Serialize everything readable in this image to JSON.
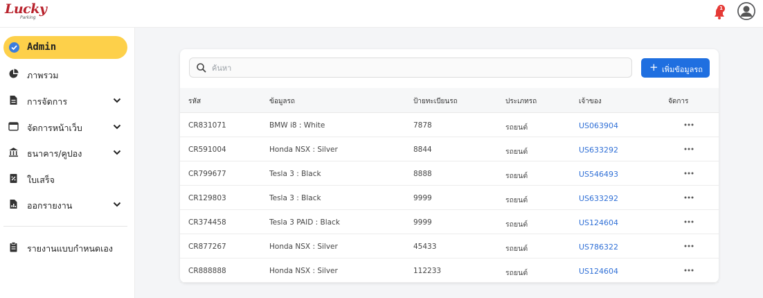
{
  "brand": {
    "logo_text": "Lucky",
    "logo_sub": "Parking"
  },
  "header": {
    "notification_count": "1"
  },
  "sidebar": {
    "active": {
      "label": "Admin"
    },
    "items": [
      {
        "label": "ภาพรวม",
        "icon": "pie-chart-icon",
        "expandable": false
      },
      {
        "label": "การจัดการ",
        "icon": "document-icon",
        "expandable": true
      },
      {
        "label": "จัดการหน้าเว็บ",
        "icon": "browser-window-icon",
        "expandable": true
      },
      {
        "label": "ธนาคาร/คูปอง",
        "icon": "bank-icon",
        "expandable": true
      },
      {
        "label": "ใบเสร็จ",
        "icon": "receipt-icon",
        "expandable": false
      },
      {
        "label": "ออกรายงาน",
        "icon": "report-icon",
        "expandable": true
      }
    ],
    "custom_report": {
      "label": "รายงานแบบกำหนดเอง",
      "icon": "clipboard-icon"
    }
  },
  "search": {
    "placeholder": "ค้นหา",
    "value": ""
  },
  "toolbar": {
    "add_label": "เพิ่มข้อมูลรถ"
  },
  "table": {
    "columns": [
      "รหัส",
      "ข้อมูลรถ",
      "ป้ายทะเบียนรถ",
      "ประเภทรถ",
      "เจ้าของ",
      "จัดการ"
    ],
    "rows": [
      {
        "id": "CR831071",
        "info": "BMW i8 : White",
        "plate": "7878",
        "type": "รถยนต์",
        "owner": "US063904"
      },
      {
        "id": "CR591004",
        "info": "Honda NSX : Silver",
        "plate": "8844",
        "type": "รถยนต์",
        "owner": "US633292"
      },
      {
        "id": "CR799677",
        "info": "Tesla 3 : Black",
        "plate": "8888",
        "type": "รถยนต์",
        "owner": "US546493"
      },
      {
        "id": "CR129803",
        "info": "Tesla 3 : Black",
        "plate": "9999",
        "type": "รถยนต์",
        "owner": "US633292"
      },
      {
        "id": "CR374458",
        "info": "Tesla 3 PAID : Black",
        "plate": "9999",
        "type": "รถยนต์",
        "owner": "US124604"
      },
      {
        "id": "CR877267",
        "info": "Honda NSX : Silver",
        "plate": "45433",
        "type": "รถยนต์",
        "owner": "US786322"
      },
      {
        "id": "CR888888",
        "info": "Honda NSX : Silver",
        "plate": "112233",
        "type": "รถยนต์",
        "owner": "US124604"
      }
    ]
  },
  "colors": {
    "accent": "#1f6fe0",
    "active_nav": "#fdd04a",
    "brand": "#b8222c",
    "link": "#2f6fd6",
    "badge": "#e53935"
  }
}
